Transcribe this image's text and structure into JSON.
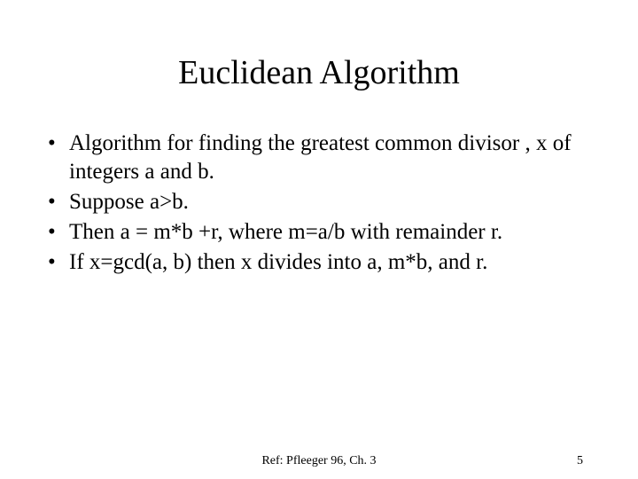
{
  "title": "Euclidean Algorithm",
  "bullets": [
    "Algorithm for finding the greatest common divisor , x of  integers a and b.",
    "Suppose a>b.",
    "Then a = m*b +r, where m=a/b with remainder r.",
    "If x=gcd(a, b) then x divides into a, m*b, and r."
  ],
  "footer": {
    "ref": "Ref: Pfleeger 96, Ch. 3",
    "page": "5"
  }
}
